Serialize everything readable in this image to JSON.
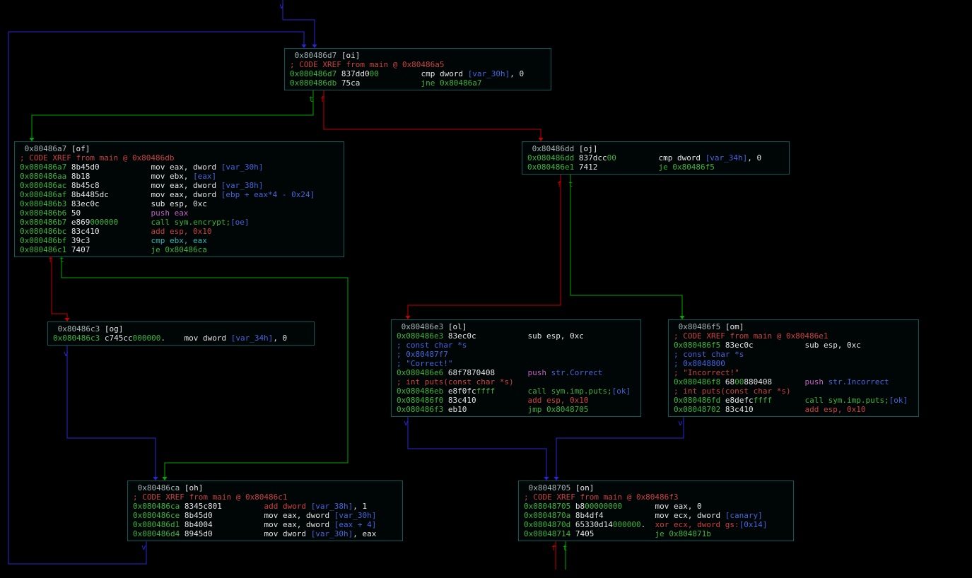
{
  "app": {
    "name": "radare2 graph view",
    "function": "main"
  },
  "palette": {
    "bg": "#000000",
    "block_bg": "#000505",
    "block_border": "#0b5a5a",
    "w": "#e4e4e4",
    "g": "#3cb43c",
    "r": "#cd4040",
    "b": "#4465dd",
    "m": "#c45fc4",
    "c": "#35b2b2",
    "hd": "#a5b5b5",
    "edge_true": "#00a800",
    "edge_false": "#c40000",
    "edge_flow": "#2727d8"
  },
  "blocks": [
    {
      "id": "oi",
      "title": "0x80486d7",
      "tag": "[oi]",
      "lines": [
        [
          [
            "hd",
            " 0x80486d7 "
          ],
          [
            "w",
            "[oi]"
          ]
        ],
        [
          [
            "r",
            "; CODE XREF from main @ 0x80486a5"
          ]
        ],
        [
          [
            "g",
            "0x080486d7"
          ],
          [
            "w",
            " 837dd0"
          ],
          [
            "g",
            "00"
          ],
          [
            "w",
            "         "
          ],
          [
            "w",
            "cmp dword "
          ],
          [
            "b",
            "[var_30h]"
          ],
          [
            "w",
            ", 0"
          ]
        ],
        [
          [
            "g",
            "0x080486db"
          ],
          [
            "w",
            " 75ca             "
          ],
          [
            "g",
            "jne 0x80486a7"
          ]
        ]
      ]
    },
    {
      "id": "of",
      "title": "0x80486a7",
      "tag": "[of]",
      "lines": [
        [
          [
            "hd",
            " 0x80486a7 "
          ],
          [
            "w",
            "[of]"
          ]
        ],
        [
          [
            "r",
            "; CODE XREF from main @ 0x80486db"
          ]
        ],
        [
          [
            "g",
            "0x080486a7"
          ],
          [
            "w",
            " 8b45d0           "
          ],
          [
            "w",
            "mov eax, dword "
          ],
          [
            "b",
            "[var_30h]"
          ]
        ],
        [
          [
            "g",
            "0x080486aa"
          ],
          [
            "w",
            " 8b18             "
          ],
          [
            "w",
            "mov ebx, "
          ],
          [
            "b",
            "[eax]"
          ]
        ],
        [
          [
            "g",
            "0x080486ac"
          ],
          [
            "w",
            " 8b45c8           "
          ],
          [
            "w",
            "mov eax, dword "
          ],
          [
            "b",
            "[var_38h]"
          ]
        ],
        [
          [
            "g",
            "0x080486af"
          ],
          [
            "w",
            " 8b4485dc         "
          ],
          [
            "w",
            "mov eax, dword "
          ],
          [
            "b",
            "[ebp + eax*4 - 0x24]"
          ]
        ],
        [
          [
            "g",
            "0x080486b3"
          ],
          [
            "w",
            " 83ec0c           "
          ],
          [
            "w",
            "sub esp, 0xc"
          ]
        ],
        [
          [
            "g",
            "0x080486b6"
          ],
          [
            "w",
            " 50               "
          ],
          [
            "m",
            "push eax"
          ]
        ],
        [
          [
            "g",
            "0x080486b7"
          ],
          [
            "w",
            " e869"
          ],
          [
            "g",
            "000000"
          ],
          [
            "w",
            "       "
          ],
          [
            "g",
            "call sym.encrypt"
          ],
          [
            "g",
            ";"
          ],
          [
            "b",
            "[oe]"
          ]
        ],
        [
          [
            "g",
            "0x080486bc"
          ],
          [
            "w",
            " 83c410           "
          ],
          [
            "r",
            "add esp, 0x10"
          ]
        ],
        [
          [
            "g",
            "0x080486bf"
          ],
          [
            "w",
            " 39c3             "
          ],
          [
            "c",
            "cmp ebx, eax"
          ]
        ],
        [
          [
            "g",
            "0x080486c1"
          ],
          [
            "w",
            " 7407             "
          ],
          [
            "g",
            "je 0x80486ca"
          ]
        ]
      ]
    },
    {
      "id": "oj",
      "title": "0x80486dd",
      "tag": "[oj]",
      "lines": [
        [
          [
            "hd",
            " 0x80486dd "
          ],
          [
            "w",
            "[oj]"
          ]
        ],
        [
          [
            "g",
            "0x080486dd"
          ],
          [
            "w",
            " 837dcc"
          ],
          [
            "g",
            "00"
          ],
          [
            "w",
            "         "
          ],
          [
            "w",
            "cmp dword "
          ],
          [
            "b",
            "[var_34h]"
          ],
          [
            "w",
            ", 0"
          ]
        ],
        [
          [
            "g",
            "0x080486e1"
          ],
          [
            "w",
            " 7412             "
          ],
          [
            "g",
            "je 0x80486f5"
          ]
        ]
      ]
    },
    {
      "id": "og",
      "title": "0x80486c3",
      "tag": "[og]",
      "lines": [
        [
          [
            "hd",
            " 0x80486c3 "
          ],
          [
            "w",
            "[og]"
          ]
        ],
        [
          [
            "g",
            "0x080486c3"
          ],
          [
            "w",
            " c745cc"
          ],
          [
            "g",
            "000000"
          ],
          [
            "w",
            ".    "
          ],
          [
            "w",
            "mov dword "
          ],
          [
            "b",
            "[var_34h]"
          ],
          [
            "w",
            ", 0"
          ]
        ]
      ]
    },
    {
      "id": "ol",
      "title": "0x80486e3",
      "tag": "[ol]",
      "lines": [
        [
          [
            "hd",
            " 0x80486e3 "
          ],
          [
            "w",
            "[ol]"
          ]
        ],
        [
          [
            "g",
            "0x080486e3"
          ],
          [
            "w",
            " 83ec0c           "
          ],
          [
            "w",
            "sub esp, 0xc"
          ]
        ],
        [
          [
            "b",
            "; const char *s"
          ]
        ],
        [
          [
            "b",
            "; 0x80487f7"
          ]
        ],
        [
          [
            "b",
            "; \"Correct!\""
          ]
        ],
        [
          [
            "g",
            "0x080486e6"
          ],
          [
            "w",
            " 68f7870408       "
          ],
          [
            "m",
            "push "
          ],
          [
            "b",
            "str.Correct"
          ]
        ],
        [
          [
            "r",
            "; int puts(const char *s)"
          ]
        ],
        [
          [
            "g",
            "0x080486eb"
          ],
          [
            "w",
            " e8f0fc"
          ],
          [
            "g",
            "ffff"
          ],
          [
            "w",
            "       "
          ],
          [
            "g",
            "call sym.imp.puts"
          ],
          [
            "g",
            ";"
          ],
          [
            "b",
            "[ok]"
          ]
        ],
        [
          [
            "g",
            "0x080486f0"
          ],
          [
            "w",
            " 83c410           "
          ],
          [
            "r",
            "add esp, 0x10"
          ]
        ],
        [
          [
            "g",
            "0x080486f3"
          ],
          [
            "w",
            " eb10             "
          ],
          [
            "g",
            "jmp 0x8048705"
          ]
        ]
      ]
    },
    {
      "id": "om",
      "title": "0x80486f5",
      "tag": "[om]",
      "lines": [
        [
          [
            "hd",
            " 0x80486f5 "
          ],
          [
            "w",
            "[om]"
          ]
        ],
        [
          [
            "r",
            "; CODE XREF from main @ 0x80486e1"
          ]
        ],
        [
          [
            "g",
            "0x080486f5"
          ],
          [
            "w",
            " 83ec0c           "
          ],
          [
            "w",
            "sub esp, 0xc"
          ]
        ],
        [
          [
            "b",
            "; const char *s"
          ]
        ],
        [
          [
            "b",
            "; 0x8048800"
          ]
        ],
        [
          [
            "r",
            "; \"Incorrect!\""
          ]
        ],
        [
          [
            "g",
            "0x080486f8"
          ],
          [
            "w",
            " 68"
          ],
          [
            "g",
            "00"
          ],
          [
            "w",
            "880408       "
          ],
          [
            "m",
            "push "
          ],
          [
            "b",
            "str.Incorrect"
          ]
        ],
        [
          [
            "r",
            "; int puts(const char *s)"
          ]
        ],
        [
          [
            "g",
            "0x080486fd"
          ],
          [
            "w",
            " e8defc"
          ],
          [
            "g",
            "ffff"
          ],
          [
            "w",
            "       "
          ],
          [
            "g",
            "call sym.imp.puts"
          ],
          [
            "g",
            ";"
          ],
          [
            "b",
            "[ok]"
          ]
        ],
        [
          [
            "g",
            "0x08048702"
          ],
          [
            "w",
            " 83c410           "
          ],
          [
            "r",
            "add esp, 0x10"
          ]
        ]
      ]
    },
    {
      "id": "oh",
      "title": "0x80486ca",
      "tag": "[oh]",
      "lines": [
        [
          [
            "hd",
            " 0x80486ca "
          ],
          [
            "w",
            "[oh]"
          ]
        ],
        [
          [
            "r",
            "; CODE XREF from main @ 0x80486c1"
          ]
        ],
        [
          [
            "g",
            "0x080486ca"
          ],
          [
            "w",
            " 8345c801         "
          ],
          [
            "r",
            "add dword "
          ],
          [
            "b",
            "[var_38h]"
          ],
          [
            "w",
            ", 1"
          ]
        ],
        [
          [
            "g",
            "0x080486ce"
          ],
          [
            "w",
            " 8b45d0           "
          ],
          [
            "w",
            "mov eax, dword "
          ],
          [
            "b",
            "[var_30h]"
          ]
        ],
        [
          [
            "g",
            "0x080486d1"
          ],
          [
            "w",
            " 8b4004           "
          ],
          [
            "w",
            "mov eax, dword "
          ],
          [
            "b",
            "[eax + 4]"
          ]
        ],
        [
          [
            "g",
            "0x080486d4"
          ],
          [
            "w",
            " 8945d0           "
          ],
          [
            "w",
            "mov dword "
          ],
          [
            "b",
            "[var_30h]"
          ],
          [
            "w",
            ", eax"
          ]
        ]
      ]
    },
    {
      "id": "on",
      "title": "0x8048705",
      "tag": "[on]",
      "lines": [
        [
          [
            "hd",
            " 0x8048705 "
          ],
          [
            "w",
            "[on]"
          ]
        ],
        [
          [
            "r",
            "; CODE XREF from main @ 0x80486f3"
          ]
        ],
        [
          [
            "g",
            "0x08048705"
          ],
          [
            "w",
            " b8"
          ],
          [
            "g",
            "00000000"
          ],
          [
            "w",
            "       "
          ],
          [
            "w",
            "mov eax, 0"
          ]
        ],
        [
          [
            "g",
            "0x0804870a"
          ],
          [
            "w",
            " 8b4df4           "
          ],
          [
            "w",
            "mov ecx, dword "
          ],
          [
            "b",
            "[canary]"
          ]
        ],
        [
          [
            "g",
            "0x0804870d"
          ],
          [
            "w",
            " 65330d14"
          ],
          [
            "g",
            "000000"
          ],
          [
            "w",
            ".  "
          ],
          [
            "r",
            "xor ecx, dword gs:"
          ],
          [
            "b",
            "[0x14]"
          ]
        ],
        [
          [
            "g",
            "0x08048714"
          ],
          [
            "w",
            " 7405             "
          ],
          [
            "g",
            "je 0x804871b"
          ]
        ]
      ]
    }
  ],
  "edges": [
    {
      "from": "entry",
      "to": "oi",
      "kind": "flow",
      "arrow": true
    },
    {
      "from": "oh",
      "to": "oi",
      "kind": "flow",
      "arrow": true
    },
    {
      "from": "oi",
      "to": "of",
      "kind": "true",
      "arrow": true
    },
    {
      "from": "oi",
      "to": "oj",
      "kind": "false",
      "arrow": true
    },
    {
      "from": "of",
      "to": "og",
      "kind": "false",
      "arrow": true
    },
    {
      "from": "of",
      "to": "oh",
      "kind": "true",
      "arrow": true
    },
    {
      "from": "og",
      "to": "oh",
      "kind": "flow",
      "arrow": true
    },
    {
      "from": "oj",
      "to": "ol",
      "kind": "false",
      "arrow": true
    },
    {
      "from": "oj",
      "to": "om",
      "kind": "true",
      "arrow": true
    },
    {
      "from": "ol",
      "to": "on",
      "kind": "flow",
      "arrow": true
    },
    {
      "from": "om",
      "to": "on",
      "kind": "flow",
      "arrow": true
    },
    {
      "from": "on",
      "to": "offscreen-false",
      "kind": "false",
      "arrow": false
    },
    {
      "from": "on",
      "to": "offscreen-true",
      "kind": "true",
      "arrow": false
    }
  ],
  "edge_labels": [
    {
      "text": "t",
      "kind": "true"
    },
    {
      "text": "f",
      "kind": "false"
    },
    {
      "text": "f",
      "kind": "false"
    },
    {
      "text": "t",
      "kind": "true"
    },
    {
      "text": "f",
      "kind": "false"
    },
    {
      "text": "t",
      "kind": "true"
    },
    {
      "text": "f",
      "kind": "false"
    },
    {
      "text": "t",
      "kind": "true"
    },
    {
      "text": "v",
      "kind": "flow"
    },
    {
      "text": "v",
      "kind": "flow"
    },
    {
      "text": "v",
      "kind": "flow"
    },
    {
      "text": "v",
      "kind": "flow"
    },
    {
      "text": "v",
      "kind": "flow"
    }
  ]
}
